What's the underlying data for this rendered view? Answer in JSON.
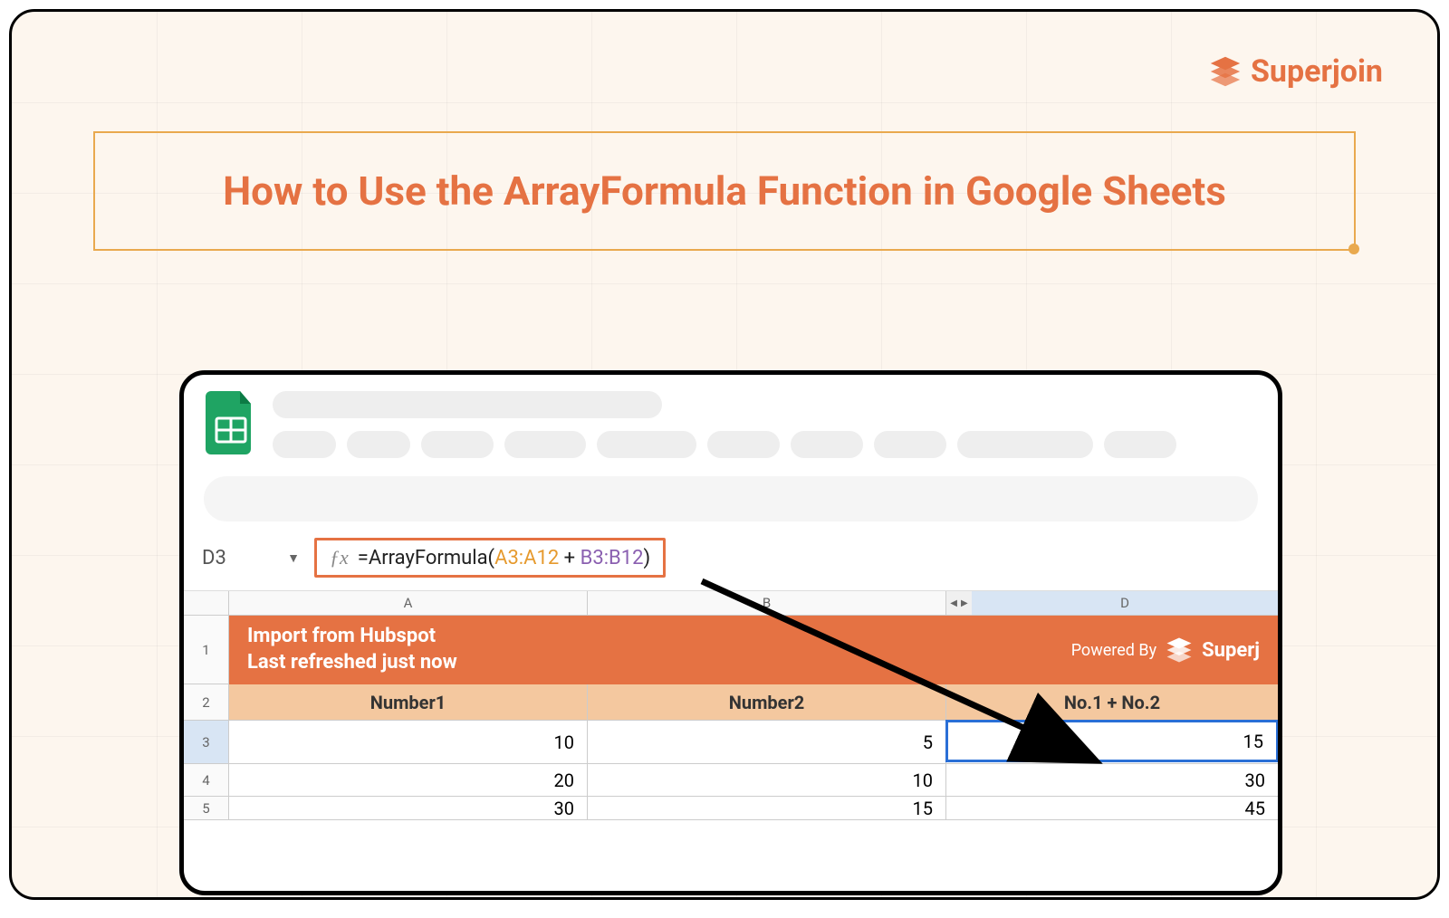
{
  "brand": {
    "name": "Superjoin"
  },
  "title": "How to Use the ArrayFormula Function in Google Sheets",
  "sheet": {
    "cell_ref": "D3",
    "formula": {
      "fx_label": "ƒx",
      "prefix": "=ArrayFormula(",
      "range1": "A3:A12",
      "op": " + ",
      "range2": "B3:B12",
      "suffix": ")"
    },
    "columns": {
      "A": "A",
      "B": "B",
      "D": "D"
    },
    "banner": {
      "line1": "Import from Hubspot",
      "line2": "Last refreshed just now",
      "powered_by_label": "Powered By",
      "powered_by_brand": "Superj"
    },
    "headers": {
      "A": "Number1",
      "B": "Number2",
      "D": "No.1 + No.2"
    },
    "rows": [
      {
        "n": "1"
      },
      {
        "n": "2"
      },
      {
        "n": "3",
        "A": "10",
        "B": "5",
        "D": "15"
      },
      {
        "n": "4",
        "A": "20",
        "B": "10",
        "D": "30"
      },
      {
        "n": "5",
        "A": "30",
        "B": "15",
        "D": "45"
      }
    ]
  }
}
